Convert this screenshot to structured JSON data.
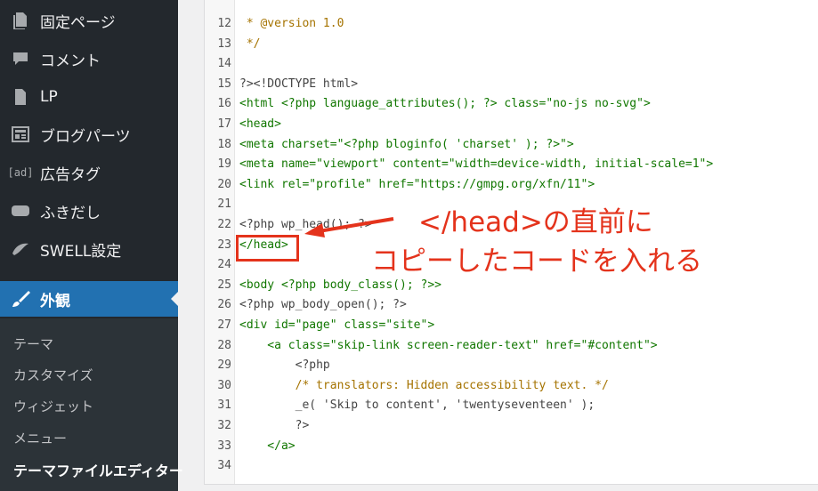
{
  "sidebar": {
    "items": [
      {
        "label": "固定ページ",
        "icon": "page-icon"
      },
      {
        "label": "コメント",
        "icon": "comment-icon"
      },
      {
        "label": "LP",
        "icon": "page-icon"
      },
      {
        "label": "ブログパーツ",
        "icon": "grid-icon"
      },
      {
        "label": "広告タグ",
        "icon": "ad-icon"
      },
      {
        "label": "ふきだし",
        "icon": "bubble-icon"
      },
      {
        "label": "SWELL設定",
        "icon": "swell-icon"
      },
      {
        "label": "外観",
        "icon": "brush-icon",
        "active": true
      }
    ],
    "ad_icon_text": "[ad]",
    "sub_items": [
      {
        "label": "テーマ"
      },
      {
        "label": "カスタマイズ"
      },
      {
        "label": "ウィジェット"
      },
      {
        "label": "メニュー"
      },
      {
        "label": "テーマファイルエディター",
        "current": true
      }
    ]
  },
  "editor": {
    "lines": [
      {
        "n": "12",
        "text": " * @version 1.0"
      },
      {
        "n": "13",
        "text": " */"
      },
      {
        "n": "14",
        "text": ""
      },
      {
        "n": "15",
        "text": "?><!DOCTYPE html>"
      },
      {
        "n": "16",
        "text": "<html <?php language_attributes(); ?> class=\"no-js no-svg\">"
      },
      {
        "n": "17",
        "text": "<head>"
      },
      {
        "n": "18",
        "text": "<meta charset=\"<?php bloginfo( 'charset' ); ?>\">"
      },
      {
        "n": "19",
        "text": "<meta name=\"viewport\" content=\"width=device-width, initial-scale=1\">"
      },
      {
        "n": "20",
        "text": "<link rel=\"profile\" href=\"https://gmpg.org/xfn/11\">"
      },
      {
        "n": "21",
        "text": ""
      },
      {
        "n": "22",
        "text": "<?php wp_head(); ?>"
      },
      {
        "n": "23",
        "text": "</head>"
      },
      {
        "n": "24",
        "text": ""
      },
      {
        "n": "25",
        "text": "<body <?php body_class(); ?>>"
      },
      {
        "n": "26",
        "text": "<?php wp_body_open(); ?>"
      },
      {
        "n": "27",
        "text": "<div id=\"page\" class=\"site\">"
      },
      {
        "n": "28",
        "text": "    <a class=\"skip-link screen-reader-text\" href=\"#content\">"
      },
      {
        "n": "29",
        "text": "        <?php"
      },
      {
        "n": "30",
        "text": "        /* translators: Hidden accessibility text. */"
      },
      {
        "n": "31",
        "text": "        _e( 'Skip to content', 'twentyseventeen' );"
      },
      {
        "n": "32",
        "text": "        ?>"
      },
      {
        "n": "33",
        "text": "    </a>"
      },
      {
        "n": "34",
        "text": ""
      }
    ]
  },
  "annotation": {
    "line1": "</head>の直前に",
    "line2": "コピーしたコードを入れる",
    "color": "#e4331c"
  }
}
